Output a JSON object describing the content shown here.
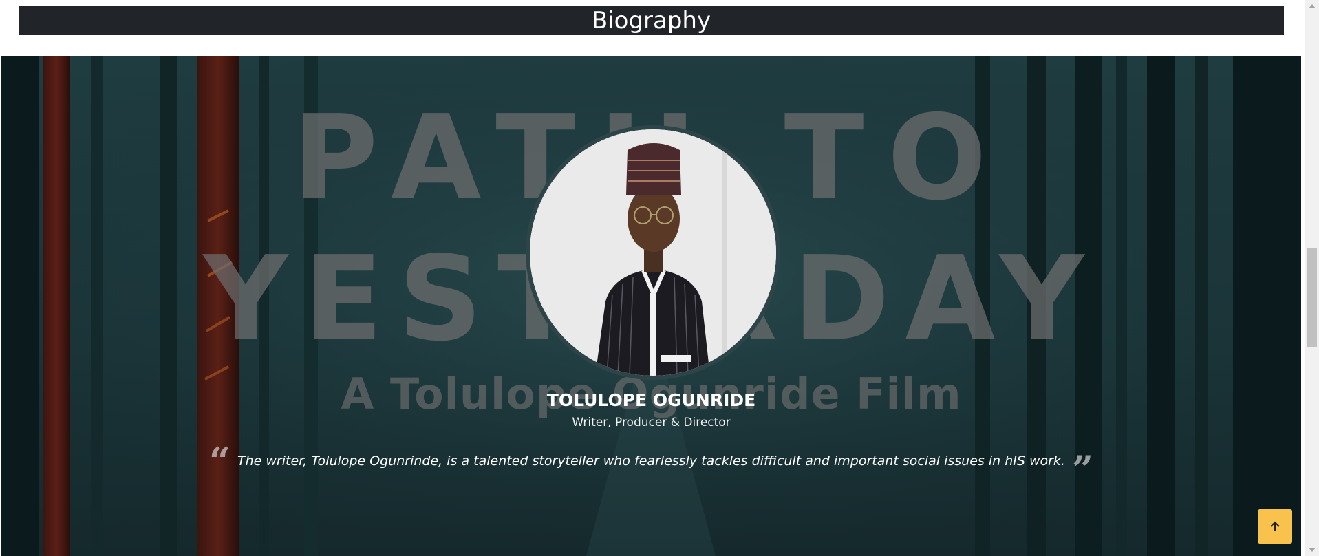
{
  "biography_header": {
    "title": "Biography"
  },
  "hero": {
    "poster_line1": "PATH TO",
    "poster_line2": "YESTERDAY",
    "poster_line3": "A Tolulope Ogunride Film",
    "person": {
      "name": "TOLULOPE OGUNRIDE",
      "role": "Writer, Producer & Director"
    },
    "quote": {
      "text": "The writer, Tolulope Ogunrinde, is a talented storyteller who fearlessly tackles difficult and important social issues in hIS work.",
      "open_mark": "“",
      "close_mark": "”"
    }
  },
  "icons": {
    "scroll_top": "arrow-up-icon",
    "quote_open": "quote-open-icon",
    "quote_close": "quote-close-icon"
  },
  "colors": {
    "header_bg": "#212529",
    "scroll_button": "#f8c24c",
    "hero_bg": "#1f3c40"
  }
}
